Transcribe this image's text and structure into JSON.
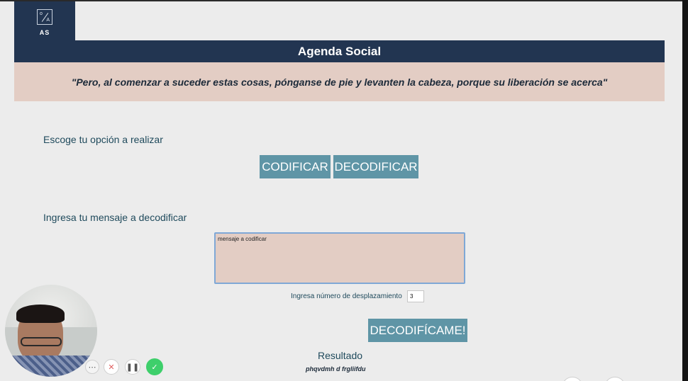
{
  "header": {
    "logo_text": "AS",
    "logo_mark": "O/A",
    "title": "Agenda Social",
    "quote": "\"Pero, al comenzar a suceder estas cosas, pónganse de pie y levanten la cabeza, porque su liberación se acerca\""
  },
  "options": {
    "label": "Escoge tu opción a realizar",
    "encode_button": "CODIFICAR",
    "decode_button": "DECODIFICAR"
  },
  "message": {
    "label": "Ingresa tu mensaje a decodificar",
    "placeholder": "mensaje a codificar",
    "value": ""
  },
  "shift": {
    "label": "Ingresa número de desplazamiento",
    "value": "3"
  },
  "action": {
    "run_button": "DECODIFÍCAME!"
  },
  "result": {
    "label": "Resultado",
    "value": "phqvdmh d frgliifdu"
  },
  "recording_controls": {
    "more": "⋯",
    "cancel": "✕",
    "pause": "❚❚",
    "done": "✓"
  },
  "colors": {
    "header_navy": "#223551",
    "quote_bg": "#e3cdc4",
    "button_teal": "#5f95a6",
    "text_teal": "#1f4a5c",
    "done_green": "#3ecf6b"
  }
}
